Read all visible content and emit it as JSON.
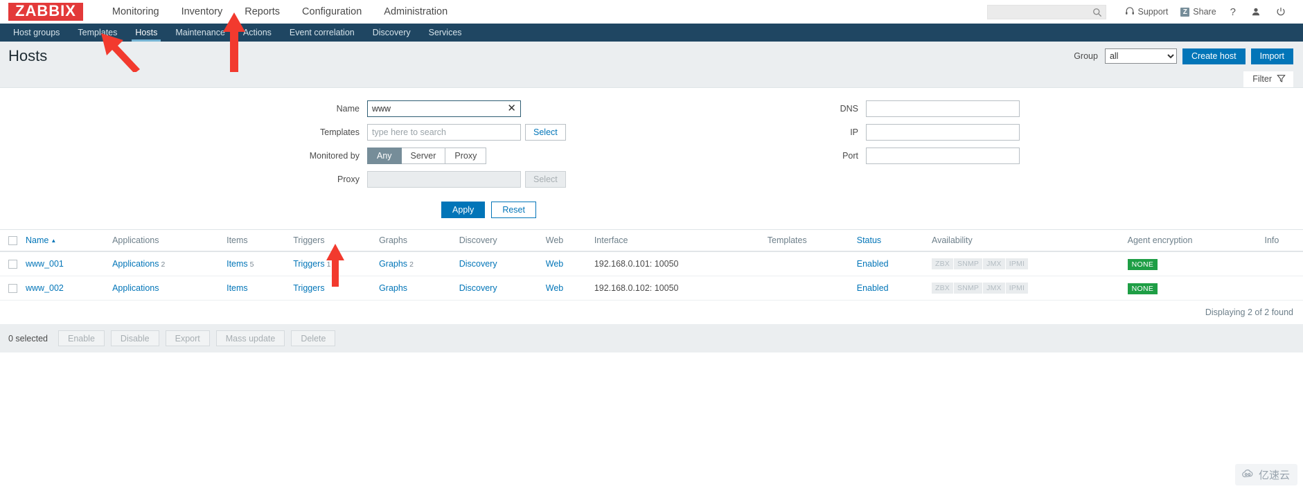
{
  "brand": {
    "logo_text": "ZABBIX",
    "logo_bg": "#e33939"
  },
  "header": {
    "nav": [
      {
        "label": "Monitoring"
      },
      {
        "label": "Inventory"
      },
      {
        "label": "Reports"
      },
      {
        "label": "Configuration"
      },
      {
        "label": "Administration"
      }
    ],
    "search": {
      "value": "",
      "placeholder": "",
      "icon": "search-icon"
    },
    "support_label": "Support",
    "share_label": "Share",
    "share_icon_letter": "Z",
    "help_label": "?",
    "user_icon": "user-icon",
    "signout_icon": "power-icon"
  },
  "subnav": {
    "items": [
      {
        "label": "Host groups",
        "active": false
      },
      {
        "label": "Templates",
        "active": false
      },
      {
        "label": "Hosts",
        "active": true
      },
      {
        "label": "Maintenance",
        "active": false
      },
      {
        "label": "Actions",
        "active": false
      },
      {
        "label": "Event correlation",
        "active": false
      },
      {
        "label": "Discovery",
        "active": false
      },
      {
        "label": "Services",
        "active": false
      }
    ]
  },
  "page": {
    "title": "Hosts",
    "group_label": "Group",
    "group_value": "all",
    "group_options": [
      "all"
    ],
    "create_host_label": "Create host",
    "import_label": "Import"
  },
  "filter_tab": {
    "label": "Filter",
    "icon": "funnel-icon"
  },
  "filter": {
    "name_label": "Name",
    "name_value": "www",
    "name_clear_icon": "close-icon",
    "templates_label": "Templates",
    "templates_value": "",
    "templates_placeholder": "type here to search",
    "templates_select_label": "Select",
    "monitored_by_label": "Monitored by",
    "monitored_by_options": [
      "Any",
      "Server",
      "Proxy"
    ],
    "monitored_by_selected": "Any",
    "proxy_label": "Proxy",
    "proxy_value": "",
    "proxy_select_label": "Select",
    "dns_label": "DNS",
    "dns_value": "",
    "ip_label": "IP",
    "ip_value": "",
    "port_label": "Port",
    "port_value": "",
    "apply_label": "Apply",
    "reset_label": "Reset"
  },
  "table": {
    "columns": [
      "Name",
      "Applications",
      "Items",
      "Triggers",
      "Graphs",
      "Discovery",
      "Web",
      "Interface",
      "Templates",
      "Status",
      "Availability",
      "Agent encryption",
      "Info"
    ],
    "sort_column": "Name",
    "sort_direction": "asc",
    "rows": [
      {
        "name": "www_001",
        "applications": "Applications",
        "applications_count": "2",
        "items": "Items",
        "items_count": "5",
        "triggers": "Triggers",
        "triggers_count": "1",
        "graphs": "Graphs",
        "graphs_count": "2",
        "discovery": "Discovery",
        "web": "Web",
        "interface": "192.168.0.101: 10050",
        "templates": "",
        "status": "Enabled",
        "availability": [
          "ZBX",
          "SNMP",
          "JMX",
          "IPMI"
        ],
        "agent_encryption": "NONE",
        "info": ""
      },
      {
        "name": "www_002",
        "applications": "Applications",
        "applications_count": "",
        "items": "Items",
        "items_count": "",
        "triggers": "Triggers",
        "triggers_count": "",
        "graphs": "Graphs",
        "graphs_count": "",
        "discovery": "Discovery",
        "web": "Web",
        "interface": "192.168.0.102: 10050",
        "templates": "",
        "status": "Enabled",
        "availability": [
          "ZBX",
          "SNMP",
          "JMX",
          "IPMI"
        ],
        "agent_encryption": "NONE",
        "info": ""
      }
    ],
    "displaying": "Displaying 2 of 2 found"
  },
  "footer": {
    "selected_text": "0 selected",
    "buttons": [
      "Enable",
      "Disable",
      "Export",
      "Mass update",
      "Delete"
    ]
  },
  "watermark": {
    "text": "亿速云",
    "icon": "cloud-icon"
  },
  "colors": {
    "accent": "#0275b8",
    "navbar": "#1f4662",
    "brand_red": "#e33939",
    "status_enabled": "#59a659",
    "badge_green": "#1e9e45",
    "annotation_red": "#f23a2e"
  }
}
